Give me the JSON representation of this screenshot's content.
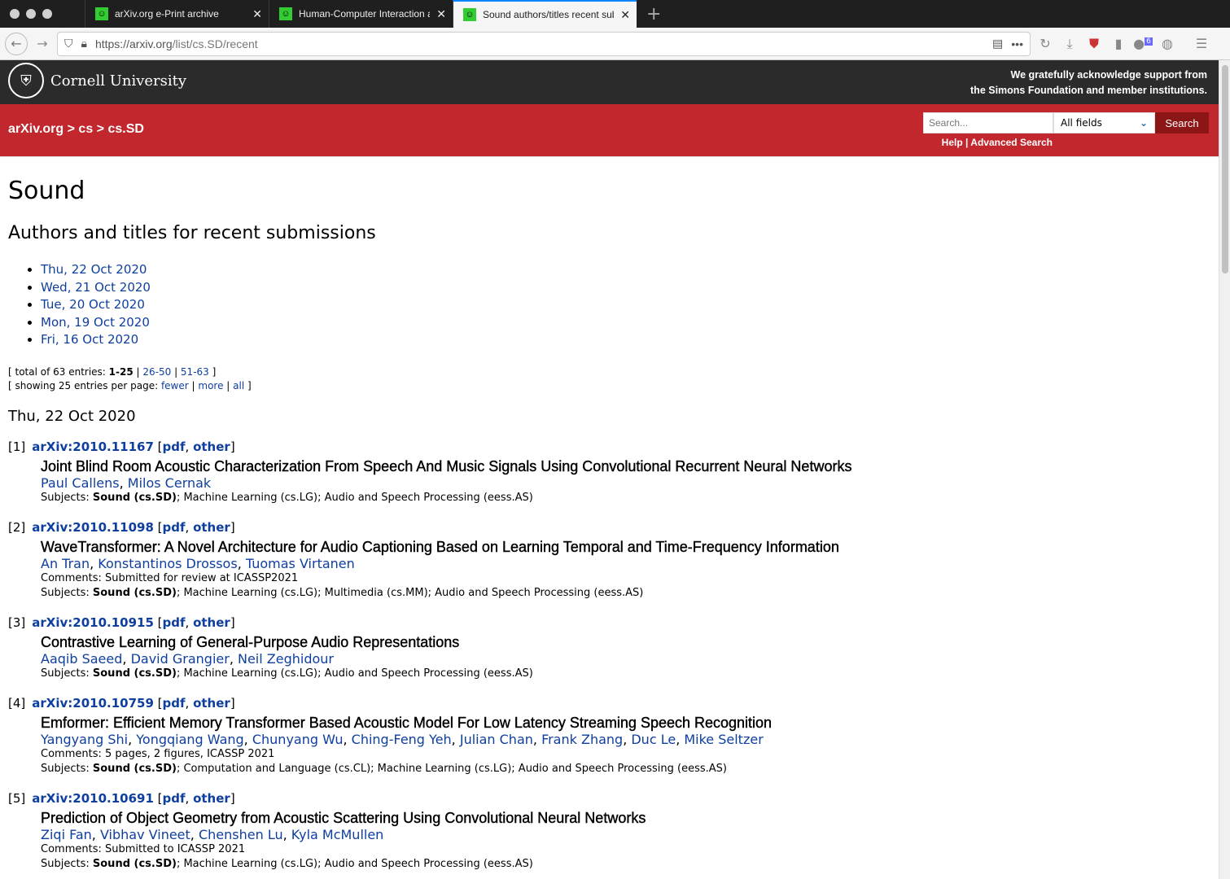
{
  "browser": {
    "tabs": [
      {
        "title": "arXiv.org e-Print archive"
      },
      {
        "title": "Human-Computer Interaction a"
      },
      {
        "title": "Sound authors/titles recent sub"
      }
    ],
    "url_host": "https://arxiv.org",
    "url_path": "/list/cs.SD/recent",
    "badge_count": "6"
  },
  "header": {
    "university": "Cornell University",
    "ack_line1": "We gratefully acknowledge support from",
    "ack_line2": "the Simons Foundation and member institutions."
  },
  "nav": {
    "crumb_root": "arXiv.org",
    "crumb_cs": "cs",
    "crumb_sd": "cs.SD",
    "sep": ">",
    "search_placeholder": "Search...",
    "field_select": "All fields",
    "search_button": "Search",
    "help": "Help",
    "advanced": "Advanced Search"
  },
  "page": {
    "title": "Sound",
    "subtitle": "Authors and titles for recent submissions",
    "days": [
      "Thu, 22 Oct 2020",
      "Wed, 21 Oct 2020",
      "Tue, 20 Oct 2020",
      "Mon, 19 Oct 2020",
      "Fri, 16 Oct 2020"
    ],
    "total_prefix": "[ total of 63 entries: ",
    "range_current": "1-25",
    "range2": "26-50",
    "range3": "51-63",
    "showing_prefix": "[ showing 25 entries per page: ",
    "fewer": "fewer",
    "more": "more",
    "all": "all",
    "section": "Thu, 22 Oct 2020"
  },
  "entries": [
    {
      "num": "[1]",
      "id": "arXiv:2010.11167",
      "title": "Joint Blind Room Acoustic Characterization From Speech And Music Signals Using Convolutional Recurrent Neural Networks",
      "authors": [
        "Paul Callens",
        "Milos Cernak"
      ],
      "comments": "",
      "primary": "Sound (cs.SD)",
      "subjects_rest": "; Machine Learning (cs.LG); Audio and Speech Processing (eess.AS)"
    },
    {
      "num": "[2]",
      "id": "arXiv:2010.11098",
      "title": "WaveTransformer: A Novel Architecture for Audio Captioning Based on Learning Temporal and Time-Frequency Information",
      "authors": [
        "An Tran",
        "Konstantinos Drossos",
        "Tuomas Virtanen"
      ],
      "comments": "Comments: Submitted for review at ICASSP2021",
      "primary": "Sound (cs.SD)",
      "subjects_rest": "; Machine Learning (cs.LG); Multimedia (cs.MM); Audio and Speech Processing (eess.AS)"
    },
    {
      "num": "[3]",
      "id": "arXiv:2010.10915",
      "title": "Contrastive Learning of General-Purpose Audio Representations",
      "authors": [
        "Aaqib Saeed",
        "David Grangier",
        "Neil Zeghidour"
      ],
      "comments": "",
      "primary": "Sound (cs.SD)",
      "subjects_rest": "; Machine Learning (cs.LG); Audio and Speech Processing (eess.AS)"
    },
    {
      "num": "[4]",
      "id": "arXiv:2010.10759",
      "title": "Emformer: Efficient Memory Transformer Based Acoustic Model For Low Latency Streaming Speech Recognition",
      "authors": [
        "Yangyang Shi",
        "Yongqiang Wang",
        "Chunyang Wu",
        "Ching-Feng Yeh",
        "Julian Chan",
        "Frank Zhang",
        "Duc Le",
        "Mike Seltzer"
      ],
      "comments": "Comments: 5 pages, 2 figures, ICASSP 2021",
      "primary": "Sound (cs.SD)",
      "subjects_rest": "; Computation and Language (cs.CL); Machine Learning (cs.LG); Audio and Speech Processing (eess.AS)"
    },
    {
      "num": "[5]",
      "id": "arXiv:2010.10691",
      "title": "Prediction of Object Geometry from Acoustic Scattering Using Convolutional Neural Networks",
      "authors": [
        "Ziqi Fan",
        "Vibhav Vineet",
        "Chenshen Lu",
        "Kyla McMullen"
      ],
      "comments": "Comments: Submitted to ICASSP 2021",
      "primary": "Sound (cs.SD)",
      "subjects_rest": "; Machine Learning (cs.LG); Audio and Speech Processing (eess.AS)"
    }
  ],
  "labels": {
    "pdf": "pdf",
    "other": "other",
    "subjects": "Subjects: "
  }
}
